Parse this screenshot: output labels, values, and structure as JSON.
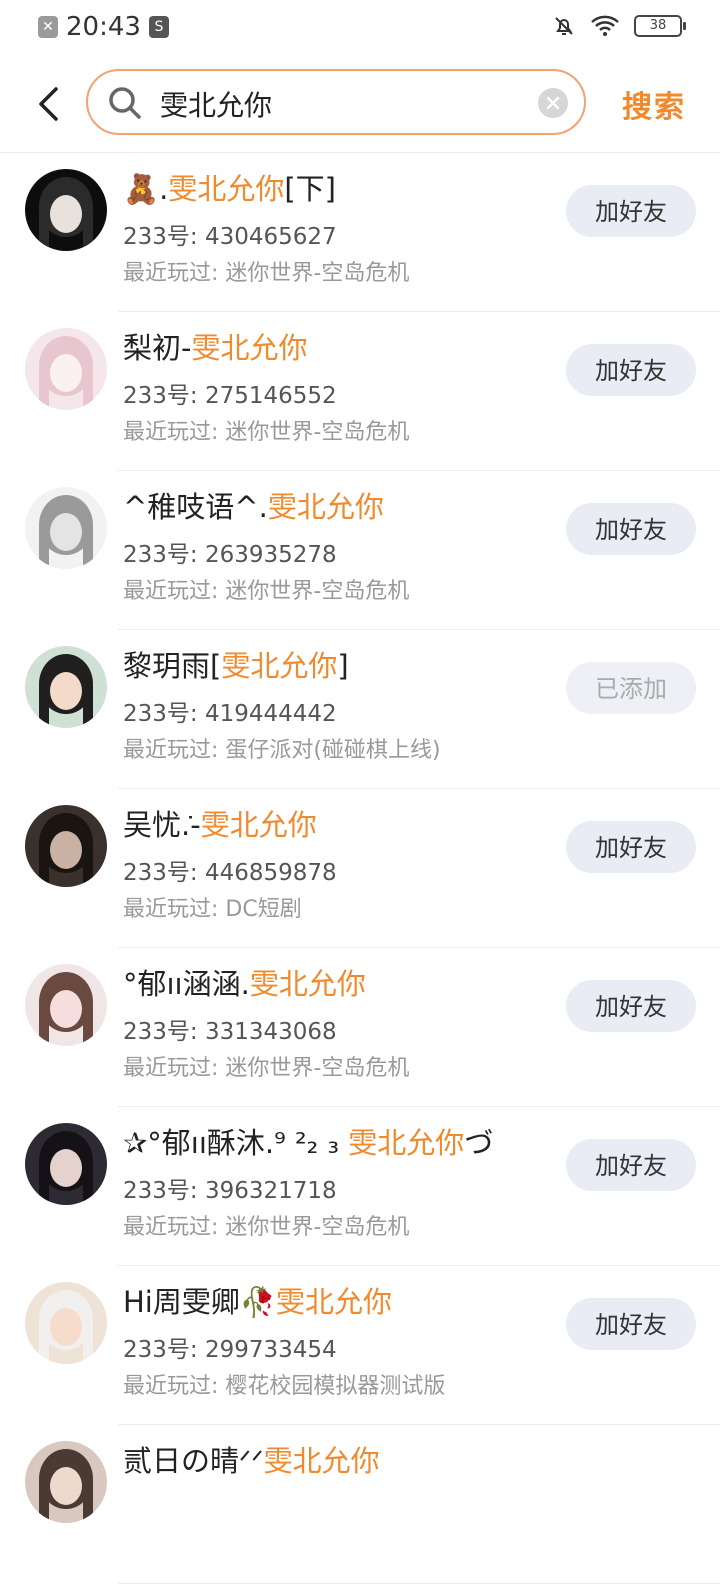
{
  "status_bar": {
    "time": "20:43",
    "battery": "38"
  },
  "header": {
    "search_query": "雯北允你",
    "search_button": "搜索"
  },
  "highlight": "雯北允你",
  "results": [
    {
      "name_prefix": "🧸.",
      "name_suffix": "[下]",
      "id": "233号: 430465627",
      "recent": "最近玩过: 迷你世界-空岛危机",
      "button": "加好友",
      "added": false,
      "avatar": {
        "bg": "#0d0d0d",
        "face": "#e9e1dc",
        "hair": "#2b2b2b"
      }
    },
    {
      "name_prefix": "梨初-",
      "name_suffix": "",
      "id": "233号: 275146552",
      "recent": "最近玩过: 迷你世界-空岛危机",
      "button": "加好友",
      "added": false,
      "avatar": {
        "bg": "#f4e6ea",
        "face": "#fbf1f1",
        "hair": "#e8c6cf"
      }
    },
    {
      "name_prefix": "^稚吱语^.",
      "name_suffix": "",
      "id": "233号: 263935278",
      "recent": "最近玩过: 迷你世界-空岛危机",
      "button": "加好友",
      "added": false,
      "avatar": {
        "bg": "#f2f2f2",
        "face": "#e4e4e4",
        "hair": "#9a9a9a"
      }
    },
    {
      "name_prefix": "黎玥雨[",
      "name_suffix": "]",
      "id": "233号: 419444442",
      "recent": "最近玩过: 蛋仔派对(碰碰棋上线)",
      "button": "已添加",
      "added": true,
      "avatar": {
        "bg": "#cfe1d4",
        "face": "#f4dac9",
        "hair": "#1f1f1f"
      }
    },
    {
      "name_prefix": "吴忧݁.-",
      "name_suffix": "",
      "id": "233号: 446859878",
      "recent": "最近玩过: DC短剧",
      "button": "加好友",
      "added": false,
      "avatar": {
        "bg": "#3a302c",
        "face": "#c9b1a3",
        "hair": "#1b1512"
      }
    },
    {
      "name_prefix": "°郁ıı涵涵.",
      "name_suffix": "",
      "id": "233号: 331343068",
      "recent": "最近玩过: 迷你世界-空岛危机",
      "button": "加好友",
      "added": false,
      "avatar": {
        "bg": "#f1e6e6",
        "face": "#f7dede",
        "hair": "#6a4a3e"
      }
    },
    {
      "name_prefix": "✰°郁ıı酥沐.⁹ ²₂ ₃ ",
      "name_suffix": "づ",
      "id": "233号: 396321718",
      "recent": "最近玩过: 迷你世界-空岛危机",
      "button": "加好友",
      "added": false,
      "avatar": {
        "bg": "#2d2a33",
        "face": "#e6d2cc",
        "hair": "#141216"
      }
    },
    {
      "name_prefix": "Hi周雯卿🥀",
      "name_suffix": "",
      "id": "233号: 299733454",
      "recent": "最近玩过: 樱花校园模拟器测试版",
      "button": "加好友",
      "added": false,
      "avatar": {
        "bg": "#efe2d6",
        "face": "#f6dccb",
        "hair": "#f2f0ee"
      }
    },
    {
      "name_prefix": "贰日の晴ᐟᐟ",
      "name_suffix": "",
      "id": "",
      "recent": "",
      "button": "",
      "added": false,
      "avatar": {
        "bg": "#d9c8c0",
        "face": "#eed9cd",
        "hair": "#4b3a33"
      }
    }
  ]
}
